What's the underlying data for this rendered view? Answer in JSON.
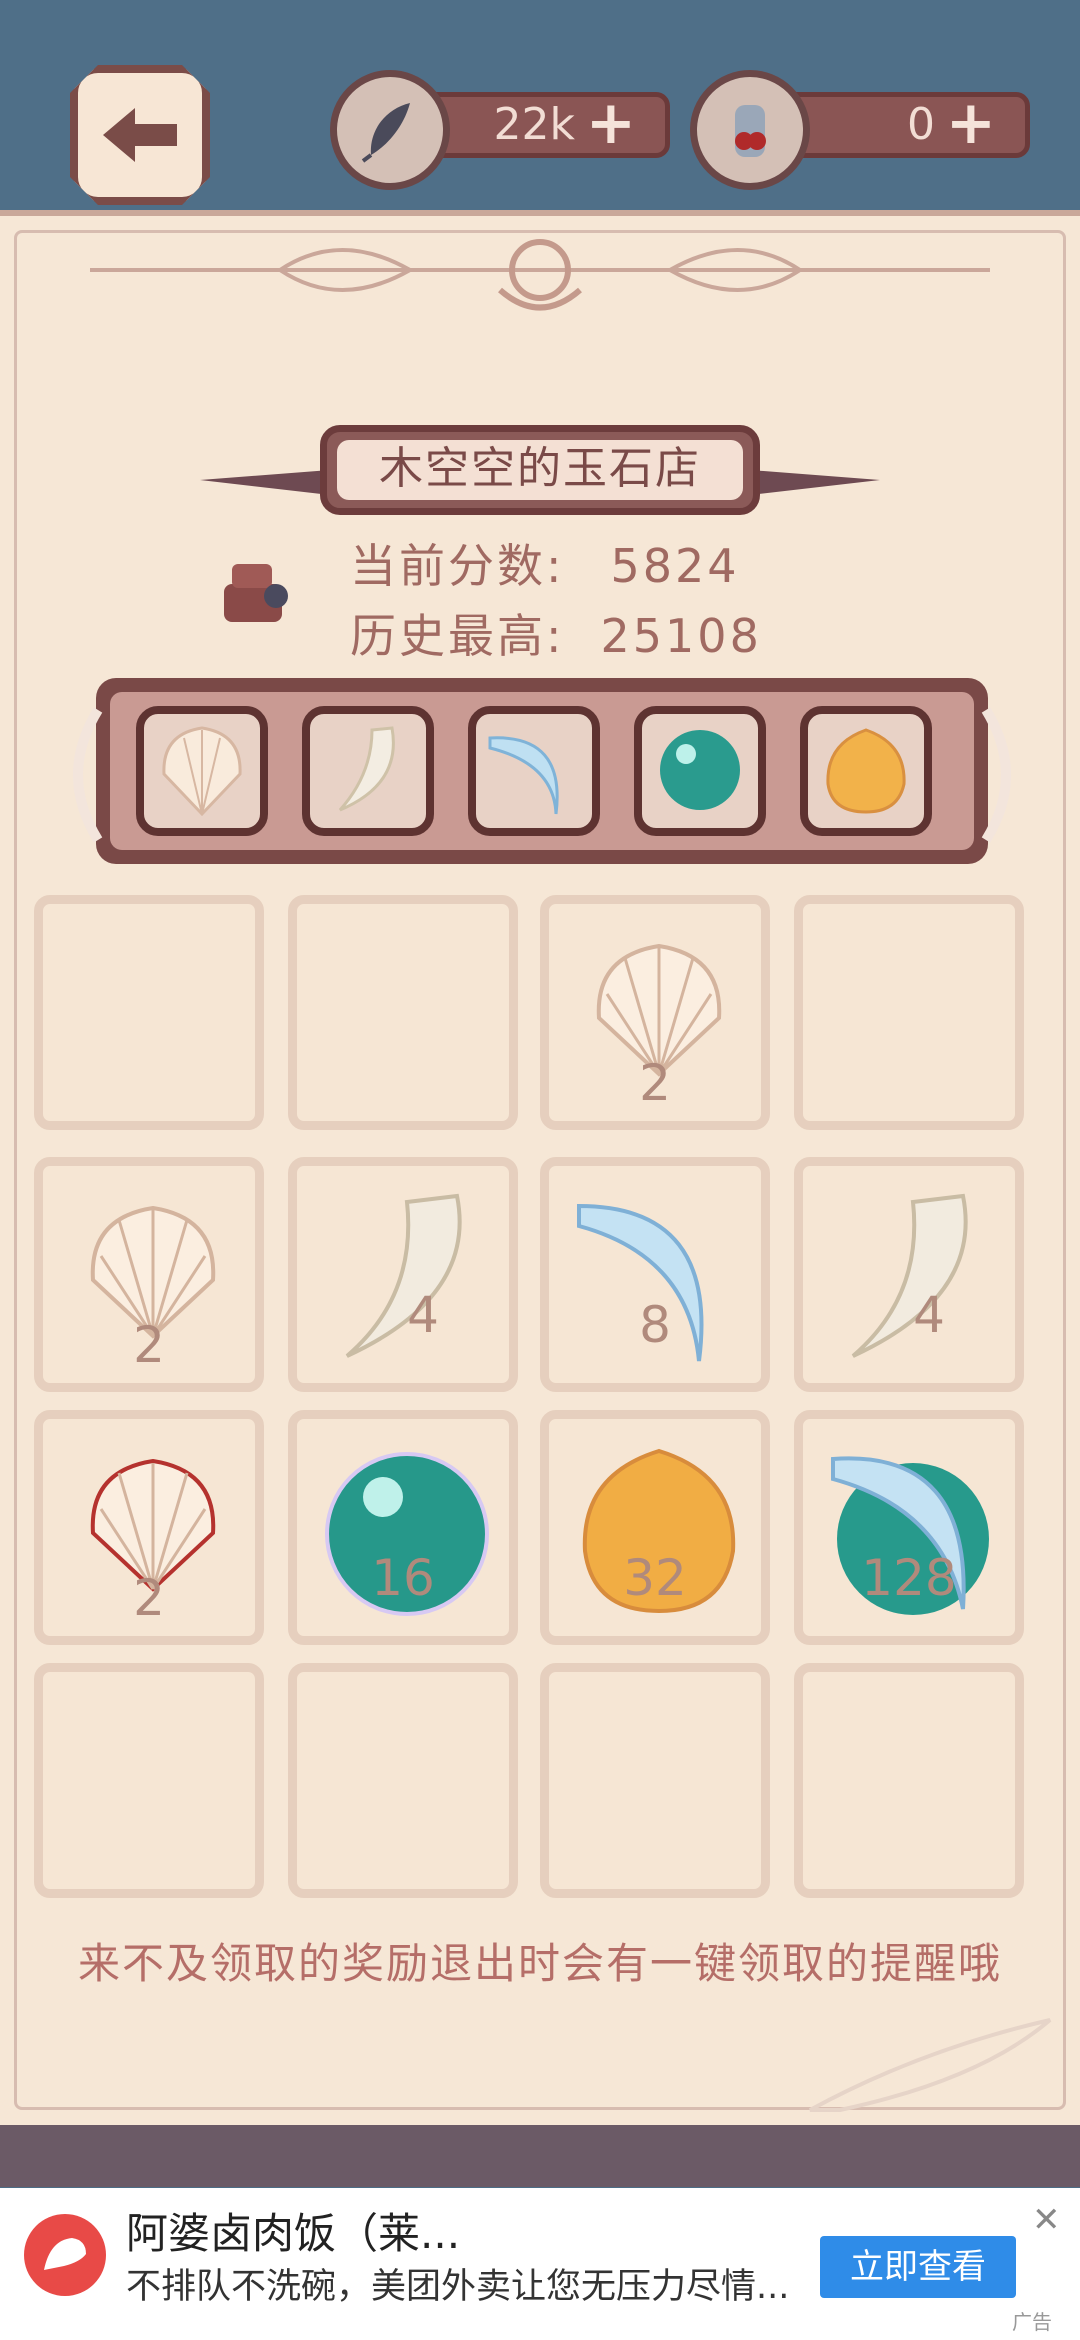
{
  "resources": {
    "feather": {
      "value": "22k",
      "icon": "feather-icon"
    },
    "potion": {
      "value": "0",
      "icon": "potion-jar-icon"
    },
    "plus_symbol": "+"
  },
  "shop": {
    "title": "木空空的玉石店",
    "current_score_label": "当前分数:",
    "current_score": "5824",
    "high_score_label": "历史最高:",
    "high_score": "25108"
  },
  "item_bar": [
    "scallop-shell-icon",
    "fang-icon",
    "blue-claw-icon",
    "teal-pearl-icon",
    "amber-gem-icon"
  ],
  "grid": [
    [
      "",
      "",
      "2",
      ""
    ],
    [
      "2",
      "4",
      "8",
      "4"
    ],
    [
      "2",
      "16",
      "32",
      "128"
    ],
    [
      "",
      "",
      "",
      ""
    ]
  ],
  "tip": "来不及领取的奖励退出时会有一键领取的提醒哦",
  "ad": {
    "title": "阿婆卤肉饭（莱...",
    "description": "不排队不洗碗，美团外卖让您无压力尽情...",
    "button": "立即查看",
    "tag": "广告",
    "close": "✕"
  }
}
